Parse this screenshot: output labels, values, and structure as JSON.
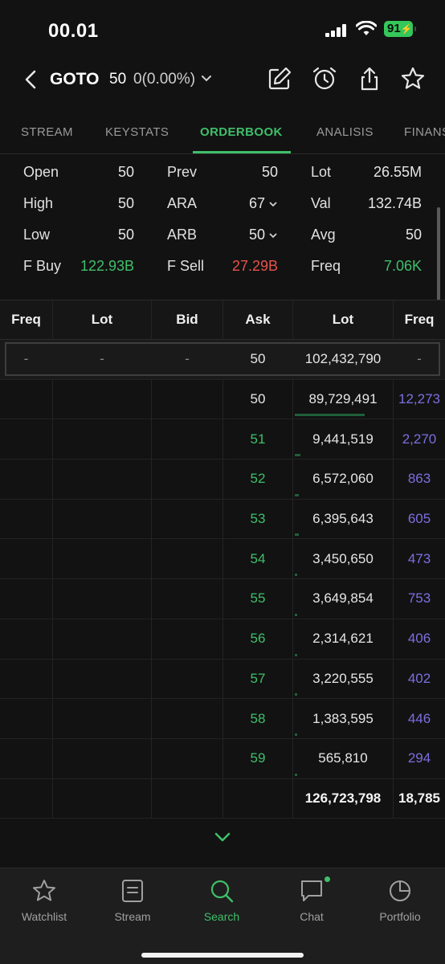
{
  "status_bar": {
    "time": "00.01",
    "battery": "91"
  },
  "header": {
    "ticker": "GOTO",
    "price": "50",
    "change": "0(0.00%)",
    "icons": [
      "back-icon",
      "edit-icon",
      "alarm-icon",
      "share-icon",
      "star-icon"
    ]
  },
  "tabs": [
    {
      "label": "STREAM"
    },
    {
      "label": "KEYSTATS"
    },
    {
      "label": "ORDERBOOK",
      "active": true
    },
    {
      "label": "ANALISIS"
    },
    {
      "label": "FINANS"
    }
  ],
  "stats": {
    "open": {
      "label": "Open",
      "value": "50"
    },
    "high": {
      "label": "High",
      "value": "50"
    },
    "low": {
      "label": "Low",
      "value": "50"
    },
    "fbuy": {
      "label": "F Buy",
      "value": "122.93B"
    },
    "prev": {
      "label": "Prev",
      "value": "50"
    },
    "ara": {
      "label": "ARA",
      "value": "67"
    },
    "arb": {
      "label": "ARB",
      "value": "50"
    },
    "fsell": {
      "label": "F Sell",
      "value": "27.29B"
    },
    "lot": {
      "label": "Lot",
      "value": "26.55M"
    },
    "val": {
      "label": "Val",
      "value": "132.74B"
    },
    "avg": {
      "label": "Avg",
      "value": "50"
    },
    "freq": {
      "label": "Freq",
      "value": "7.06K"
    }
  },
  "orderbook": {
    "headers": {
      "bid_freq": "Freq",
      "bid_lot": "Lot",
      "bid": "Bid",
      "ask": "Ask",
      "ask_lot": "Lot",
      "ask_freq": "Freq"
    },
    "first_row": {
      "bid_freq": "-",
      "bid_lot": "-",
      "bid": "-",
      "ask": "50",
      "ask_lot": "102,432,790",
      "ask_freq": "-"
    },
    "asks": [
      {
        "price": "50",
        "lot": "89,729,491",
        "freq": "12,273",
        "depth": 0.71
      },
      {
        "price": "51",
        "lot": "9,441,519",
        "freq": "2,270",
        "depth": 0.06
      },
      {
        "price": "52",
        "lot": "6,572,060",
        "freq": "863",
        "depth": 0.04
      },
      {
        "price": "53",
        "lot": "6,395,643",
        "freq": "605",
        "depth": 0.04
      },
      {
        "price": "54",
        "lot": "3,450,650",
        "freq": "473",
        "depth": 0.02
      },
      {
        "price": "55",
        "lot": "3,649,854",
        "freq": "753",
        "depth": 0.02
      },
      {
        "price": "56",
        "lot": "2,314,621",
        "freq": "406",
        "depth": 0.02
      },
      {
        "price": "57",
        "lot": "3,220,555",
        "freq": "402",
        "depth": 0.02
      },
      {
        "price": "58",
        "lot": "1,383,595",
        "freq": "446",
        "depth": 0.02
      },
      {
        "price": "59",
        "lot": "565,810",
        "freq": "294",
        "depth": 0.02
      }
    ],
    "totals": {
      "lot": "126,723,798",
      "freq": "18,785"
    }
  },
  "nav": {
    "watchlist": "Watchlist",
    "stream": "Stream",
    "search": "Search",
    "chat": "Chat",
    "portfolio": "Portfolio"
  },
  "colors": {
    "accent": "#3fbf6a",
    "negative": "#e5534b",
    "freq": "#7c6fe0",
    "background": "#121212"
  }
}
